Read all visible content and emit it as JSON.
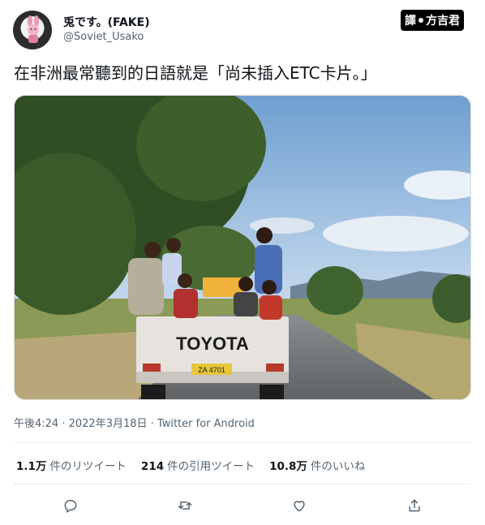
{
  "author": {
    "display_name": "兎です。(FAKE)",
    "handle": "@Soviet_Usako",
    "avatar_icon": "bunny-avatar-icon"
  },
  "stamp": {
    "left": "譯",
    "right": "方吉君"
  },
  "tweet": {
    "text": "在非洲最常聽到的日語就是「尚未插入ETC卡片。」",
    "photo": {
      "truck_brand_text": "TOYOTA",
      "plate_text": "ZA 4701"
    }
  },
  "meta": {
    "time": "午後4:24",
    "separator1": " · ",
    "date": "2022年3月18日",
    "separator2": " · ",
    "source": "Twitter for Android"
  },
  "stats": {
    "retweets": {
      "count": "1.1万",
      "label": "件のリツイート"
    },
    "quotes": {
      "count": "214",
      "label": "件の引用ツイート"
    },
    "likes": {
      "count": "10.8万",
      "label": "件のいいね"
    }
  },
  "actions": {
    "reply_icon": "reply-icon",
    "retweet_icon": "retweet-icon",
    "like_icon": "heart-icon",
    "share_icon": "share-icon"
  },
  "colors": {
    "text_primary": "#0f1419",
    "text_secondary": "#536471",
    "divider": "#e6ecf0"
  }
}
